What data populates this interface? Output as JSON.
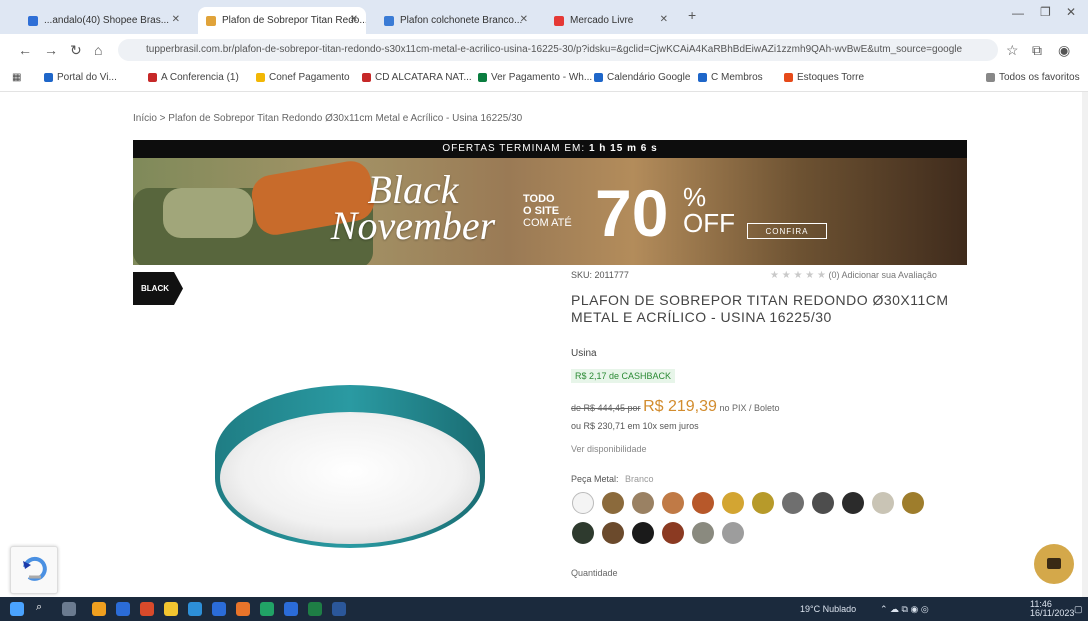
{
  "browser": {
    "tabs": [
      {
        "label": "...andalo(40) Shopee Bras...",
        "color": "#2f6fd6"
      },
      {
        "label": "Plafon de Sobrepor Titan Redo...",
        "color": "#e0a33a"
      },
      {
        "label": "Plafon colchonete Branco...",
        "color": "#3a7bd5"
      },
      {
        "label": "Mercado Livre",
        "color": "#e53935"
      }
    ],
    "new_tab": "+",
    "url": "tupperbrasil.com.br/plafon-de-sobrepor-titan-redondo-s30x11cm-metal-e-acrilico-usina-16225-30/p?idsku=&gclid=CjwKCAiA4KaRBhBdEiwAZi1zzmh9QAh-wvBwE&utm_source=google",
    "bookmarks": [
      {
        "label": "Portal do Vi...",
        "color": "#1e66c9"
      },
      {
        "label": "A Conferencia (1)",
        "color": "#c62828"
      },
      {
        "label": "Conef Pagamento",
        "color": "#f2b705"
      },
      {
        "label": "CD ALCATARA NAT...",
        "color": "#c62828"
      },
      {
        "label": "Ver Pagamento - Wh...",
        "color": "#0a7d3f"
      },
      {
        "label": "Calendário Google",
        "color": "#1e66c9"
      },
      {
        "label": "C Membros",
        "color": "#1e66c9"
      },
      {
        "label": "Estoques Torre",
        "color": "#e64a19"
      },
      {
        "label": "Todos os favoritos",
        "color": "#888888"
      }
    ]
  },
  "page": {
    "breadcrumb": "Início  >  Plafon de Sobrepor Titan Redondo Ø30x11cm Metal e Acrílico - Usina 16225/30",
    "timer_label": "OFERTAS TERMINAM EM:",
    "timer_value": "1 h 15 m 6 s",
    "banner": {
      "title_line1": "Black",
      "title_line2": "November",
      "todo": "TODO",
      "o_site": "O SITE",
      "com_ate": "COM ATÉ",
      "percent": "70",
      "percent_sign": "%",
      "off": "OFF",
      "button": "CONFIRA"
    },
    "badge": "BLACK",
    "product": {
      "sku": "SKU: 2011777",
      "stars": "★ ★ ★ ★ ★",
      "reviews": "(0)  Adicionar sua Avaliação",
      "title": "Plafon de Sobrepor Titan Redondo Ø30x11cm Metal e Acrílico - Usina 16225/30",
      "brand": "Usina",
      "cashback": "R$ 2,17 de CASHBACK",
      "price_old": "de R$ 444,45 por",
      "price_new": "R$ 219,39",
      "price_suffix": "no PIX / Boleto",
      "installments": "ou R$ 230,71 em 10x sem juros",
      "stock": "Ver disponibilidade",
      "color_label": "Peça Metal:",
      "color_value": "Branco",
      "quantity_label": "Quantidade"
    },
    "swatches": [
      "#f4f4f4",
      "#8b6a3c",
      "#9a8163",
      "#c07a46",
      "#b7582a",
      "#d3a532",
      "#b79a2a",
      "#6f6f6f",
      "#4d4d4d",
      "#2b2b2b",
      "#c9c4b5",
      "#9e7d2c",
      "#2e3a2e",
      "#6b4a2c",
      "#1a1a1a",
      "#8b3a22",
      "#8a8a7f",
      "#9d9d9d"
    ]
  },
  "taskbar": {
    "weather": "19°C  Nublado",
    "time": "11:46",
    "date": "16/11/2023"
  }
}
